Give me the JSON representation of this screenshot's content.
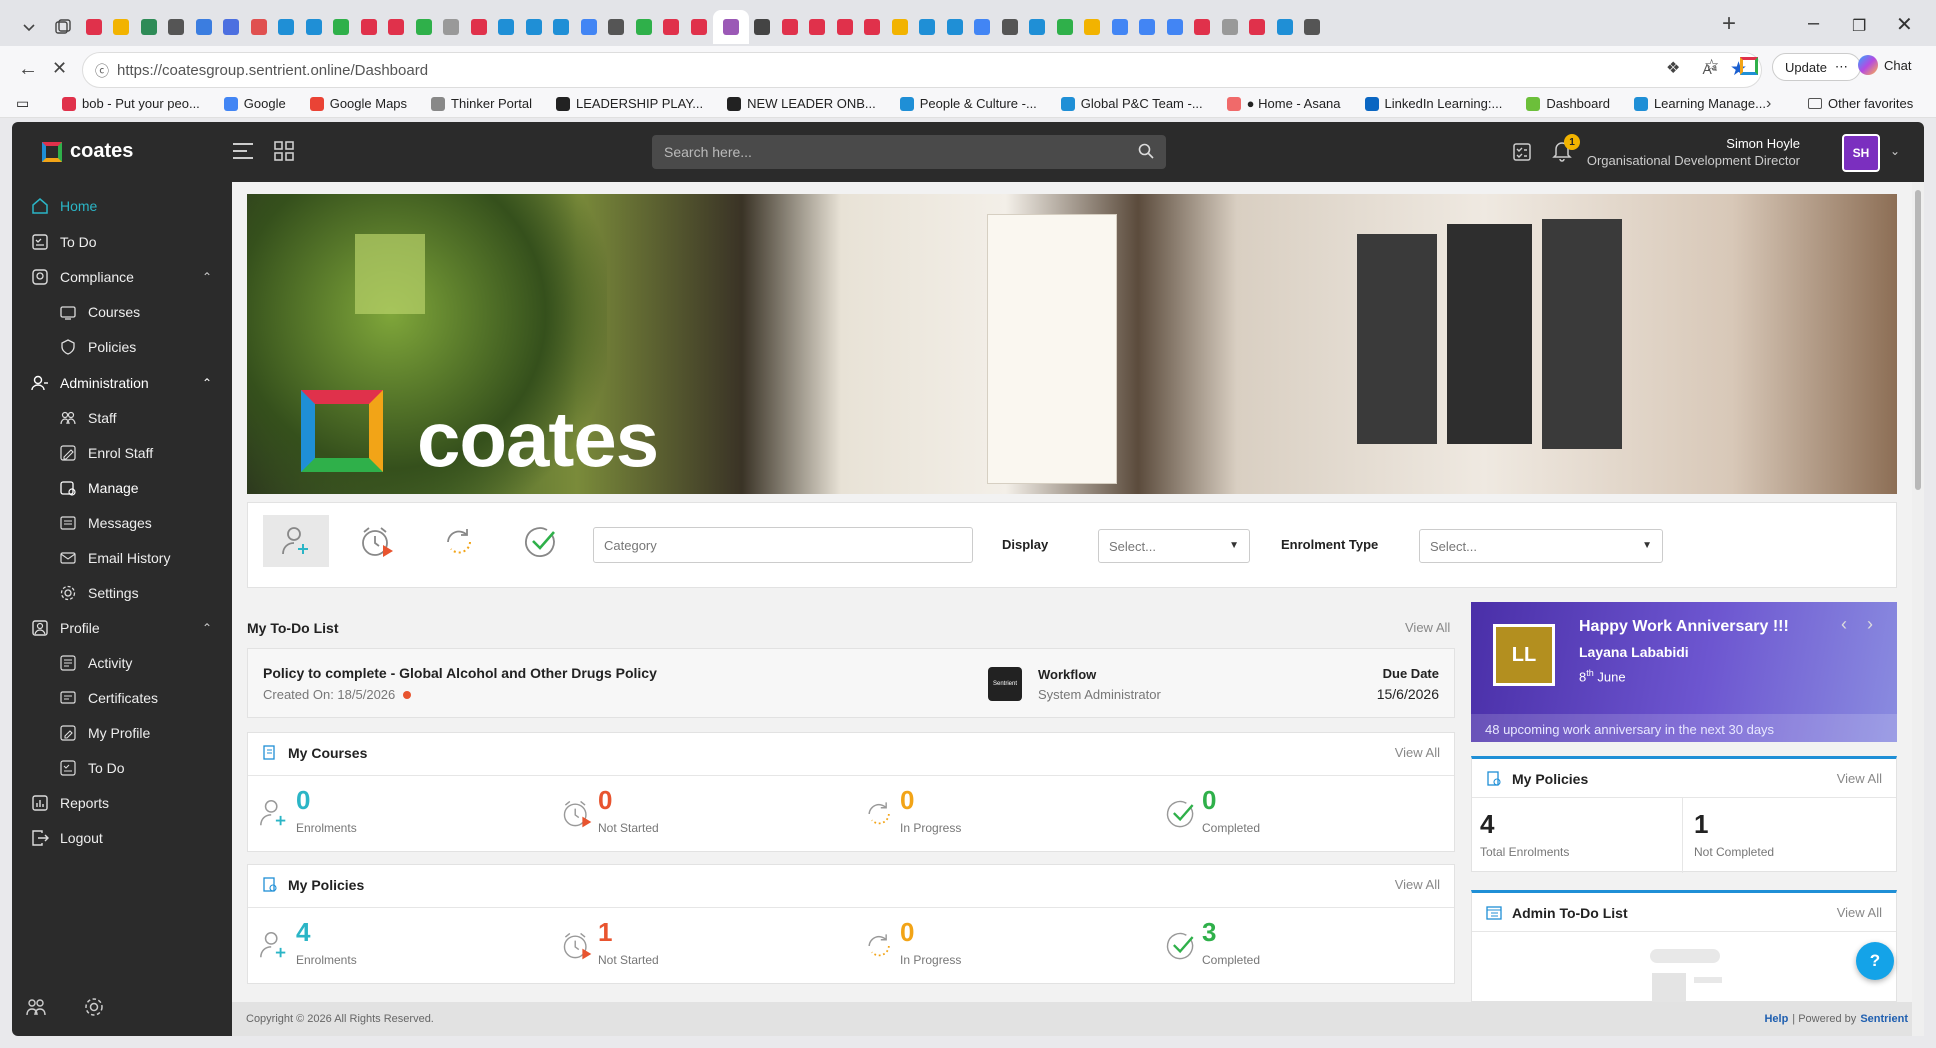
{
  "browser": {
    "url": "https://coatesgroup.sentrient.online/Dashboard",
    "update_label": "Update",
    "chat_label": "Chat",
    "bookmarks": [
      {
        "label": "bob - Put your peo...",
        "color": "#e0314b"
      },
      {
        "label": "Google",
        "color": "#4285f4"
      },
      {
        "label": "Google Maps",
        "color": "#ea4335"
      },
      {
        "label": "Thinker Portal",
        "color": "#888"
      },
      {
        "label": "LEADERSHIP PLAY...",
        "color": "#222"
      },
      {
        "label": "NEW LEADER ONB...",
        "color": "#222"
      },
      {
        "label": "People & Culture -...",
        "color": "#1f8fd6"
      },
      {
        "label": "Global P&C Team -...",
        "color": "#1f8fd6"
      },
      {
        "label": "● Home - Asana",
        "color": "#f06a6a"
      },
      {
        "label": "LinkedIn Learning:...",
        "color": "#0a66c2"
      },
      {
        "label": "Dashboard",
        "color": "#6cbf3a"
      },
      {
        "label": "Learning Manage...",
        "color": "#1f8fd6"
      }
    ],
    "other_favorites": "Other favorites"
  },
  "app": {
    "logo_text": "coates",
    "search_placeholder": "Search here...",
    "notification_count": "1",
    "user_name": "Simon Hoyle",
    "user_role": "Organisational Development Director",
    "user_initials": "SH",
    "accent": "#7b2fbf",
    "nav": {
      "home": "Home",
      "todo": "To Do",
      "compliance": "Compliance",
      "courses": "Courses",
      "policies": "Policies",
      "administration": "Administration",
      "staff": "Staff",
      "enrol_staff": "Enrol Staff",
      "manage": "Manage",
      "messages": "Messages",
      "email_history": "Email History",
      "settings": "Settings",
      "profile": "Profile",
      "activity": "Activity",
      "certificates": "Certificates",
      "my_profile": "My Profile",
      "todo2": "To Do",
      "reports": "Reports",
      "logout": "Logout"
    }
  },
  "banner": {
    "brand_text": "coates"
  },
  "filters": {
    "category_placeholder": "Category",
    "display_label": "Display",
    "display_value": "Select...",
    "enrolment_label": "Enrolment Type",
    "enrolment_value": "Select..."
  },
  "todo": {
    "title": "My To-Do List",
    "view_all": "View All",
    "item_title": "Policy to complete - Global Alcohol and Other Drugs Policy",
    "created": "Created On: 18/5/2026",
    "workflow_label": "Workflow",
    "workflow_by": "System Administrator",
    "due_label": "Due Date",
    "due_value": "15/6/2026",
    "logo_text": "Sentrient"
  },
  "anniversary": {
    "title": "Happy Work Anniversary !!!",
    "name": "Layana Lababidi",
    "initials": "LL",
    "day": "8",
    "suffix": "th",
    "month": "June",
    "footer": "48 upcoming work anniversary in the next 30 days"
  },
  "my_courses": {
    "title": "My Courses",
    "view_all": "View All",
    "stats": [
      {
        "value": "0",
        "label": "Enrolments",
        "color": "#2bb5c6"
      },
      {
        "value": "0",
        "label": "Not Started",
        "color": "#e8542f"
      },
      {
        "value": "0",
        "label": "In Progress",
        "color": "#f2a417"
      },
      {
        "value": "0",
        "label": "Completed",
        "color": "#2fb04a"
      }
    ]
  },
  "my_policies": {
    "title": "My Policies",
    "view_all": "View All",
    "stats": [
      {
        "value": "4",
        "label": "Enrolments",
        "color": "#2bb5c6"
      },
      {
        "value": "1",
        "label": "Not Started",
        "color": "#e8542f"
      },
      {
        "value": "0",
        "label": "In Progress",
        "color": "#f2a417"
      },
      {
        "value": "3",
        "label": "Completed",
        "color": "#2fb04a"
      }
    ]
  },
  "side_policies": {
    "title": "My Policies",
    "view_all": "View All",
    "total_value": "4",
    "total_label": "Total Enrolments",
    "notc_value": "1",
    "notc_label": "Not Completed"
  },
  "admin_todo": {
    "title": "Admin To-Do List",
    "view_all": "View All"
  },
  "footer": {
    "copyright": "Copyright © 2026 All Rights Reserved.",
    "help": "Help",
    "powered": "| Powered by",
    "brand": "Sentrient"
  },
  "help_button": "?"
}
